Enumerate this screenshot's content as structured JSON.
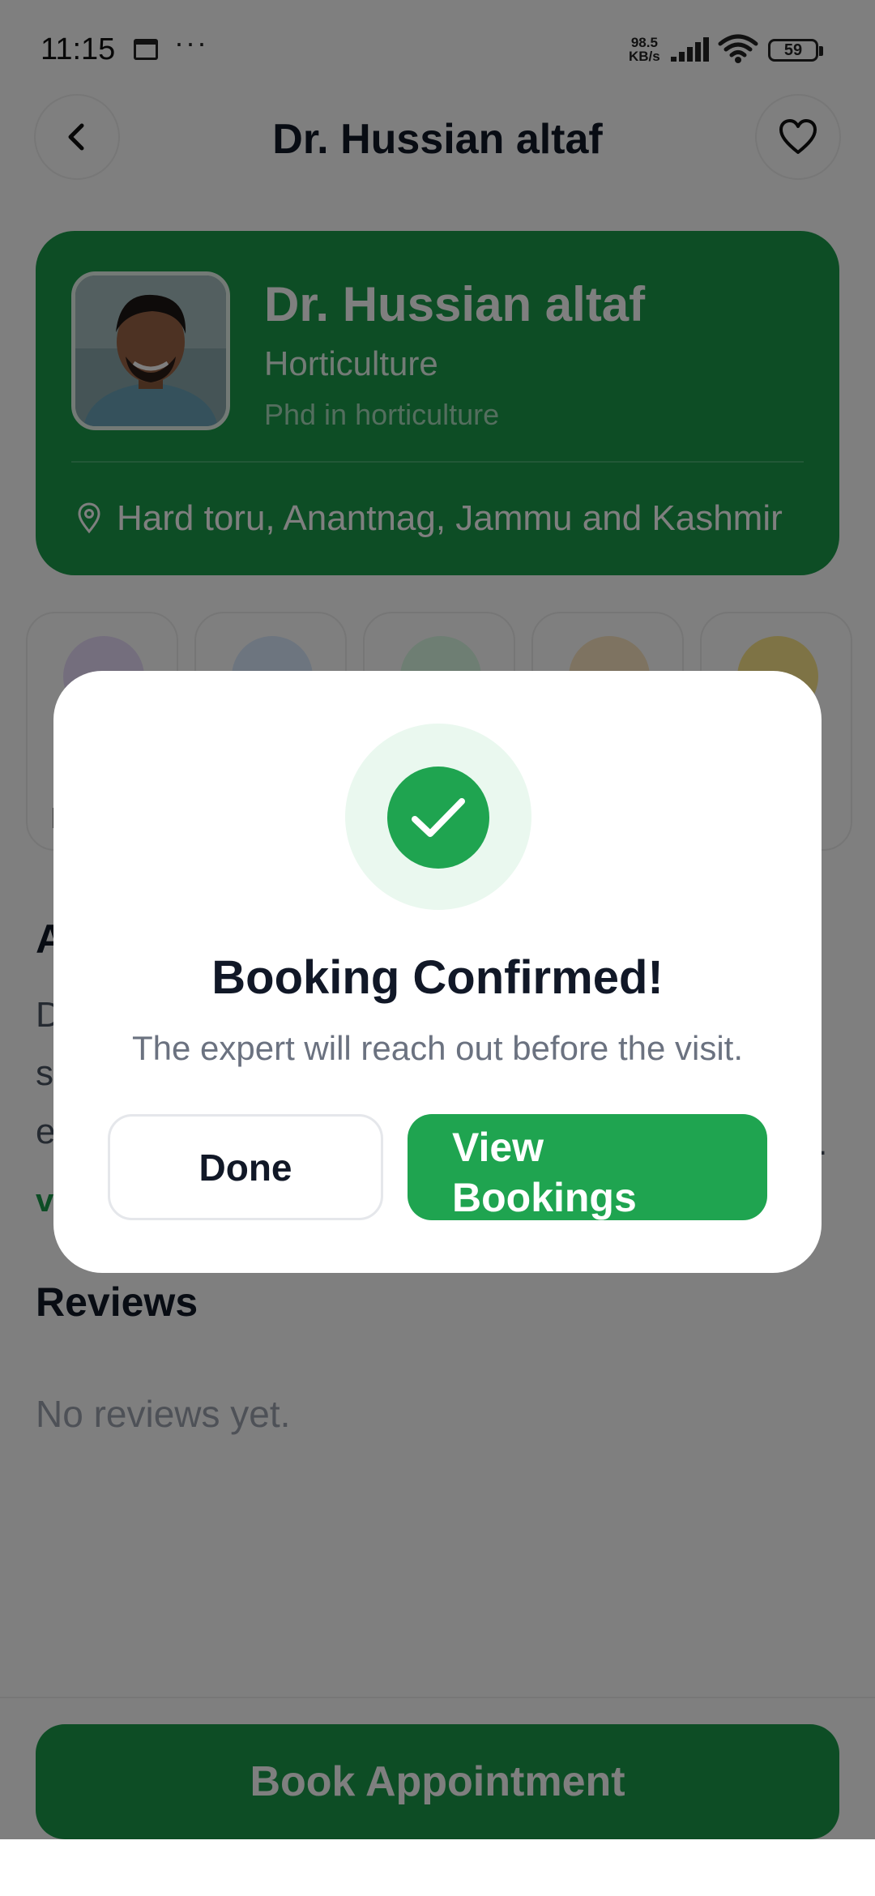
{
  "status_bar": {
    "time": "11:15",
    "network_speed_value": "98.5",
    "network_speed_unit": "KB/s",
    "battery": "59",
    "icons": [
      "calendar-icon",
      "more-dots-icon",
      "signal-icon",
      "wifi-icon",
      "battery-icon"
    ]
  },
  "header": {
    "title": "Dr. Hussian altaf",
    "back_icon": "chevron-left-icon",
    "favorite_icon": "heart-icon"
  },
  "profile": {
    "name": "Dr. Hussian altaf",
    "specialty": "Horticulture",
    "degree": "Phd in horticulture",
    "location": "Hard toru, Anantnag, Jammu and Kashmir",
    "location_icon": "map-pin-icon",
    "card_color": "#1b9a4a"
  },
  "stats": {
    "first_label_fragment": "I",
    "circle_colors": [
      "#e9ddfb",
      "#dbeafe",
      "#dcfce7",
      "#fde7c2",
      "#fde68a"
    ]
  },
  "about": {
    "title_fragment": "A",
    "line_fragments": [
      "D",
      "s",
      "e"
    ],
    "more_fragment": "v",
    "ellipsis": "."
  },
  "reviews": {
    "title": "Reviews",
    "empty_text": "No reviews yet."
  },
  "bottom": {
    "book_label": "Book Appointment"
  },
  "modal": {
    "icon": "check-icon",
    "title": "Booking Confirmed!",
    "message": "The expert will reach out before the visit.",
    "done_label": "Done",
    "view_label_line1": "View",
    "view_label_line2": "Bookings",
    "accent": "#1fa450"
  }
}
